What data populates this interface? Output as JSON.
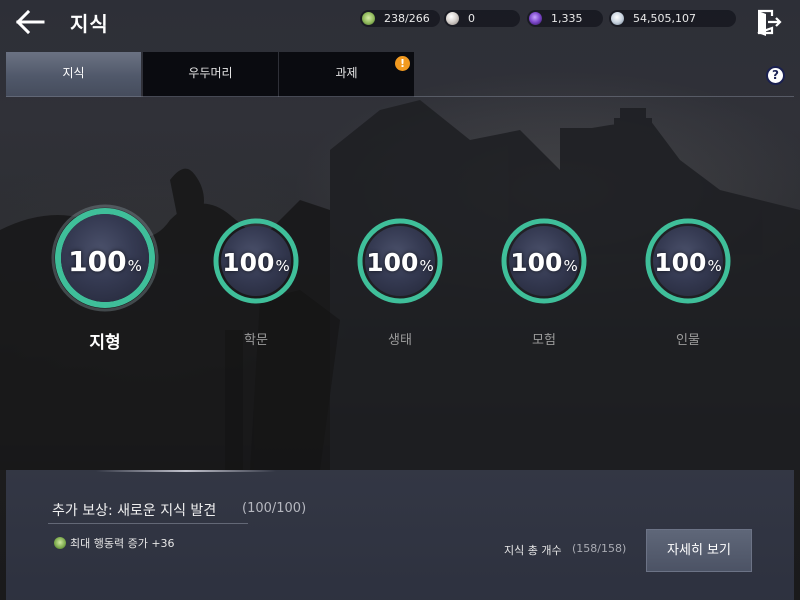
{
  "header": {
    "title": "지식",
    "back_icon": "back-arrow-icon",
    "exit_icon": "exit-door-icon",
    "resources": [
      {
        "name": "action-power",
        "icon": "leaf-badge-icon",
        "value": "238/266",
        "color": "#8fb95a"
      },
      {
        "name": "pearl",
        "icon": "pearl-icon",
        "value": "0",
        "color": "#d9d4d0"
      },
      {
        "name": "dark-crystal",
        "icon": "purple-orb-icon",
        "value": "1,335",
        "color": "#7a45c8"
      },
      {
        "name": "silver",
        "icon": "silver-coin-icon",
        "value": "54,505,107",
        "color": "#c9d4e0"
      }
    ]
  },
  "tabs": [
    {
      "label": "지식",
      "active": true
    },
    {
      "label": "우두머리",
      "active": false
    },
    {
      "label": "과제",
      "active": false,
      "badge": "!"
    }
  ],
  "help_label": "?",
  "categories": [
    {
      "name": "지형",
      "percent": "100",
      "unit": "%",
      "selected": true
    },
    {
      "name": "학문",
      "percent": "100",
      "unit": "%",
      "selected": false
    },
    {
      "name": "생태",
      "percent": "100",
      "unit": "%",
      "selected": false
    },
    {
      "name": "모험",
      "percent": "100",
      "unit": "%",
      "selected": false
    },
    {
      "name": "인물",
      "percent": "100",
      "unit": "%",
      "selected": false
    }
  ],
  "bottom": {
    "reward_title": "추가 보상: 새로운 지식 발견",
    "reward_count": "(100/100)",
    "reward_item": "최대 행동력 증가 +36",
    "total_label": "지식 총 개수",
    "total_count": "(158/158)",
    "detail_button": "자세히 보기"
  },
  "colors": {
    "ring": "#3fbf9a",
    "ring_inner": "#1b2a33",
    "tab_active": "#5a6274",
    "badge": "#f29a20"
  }
}
